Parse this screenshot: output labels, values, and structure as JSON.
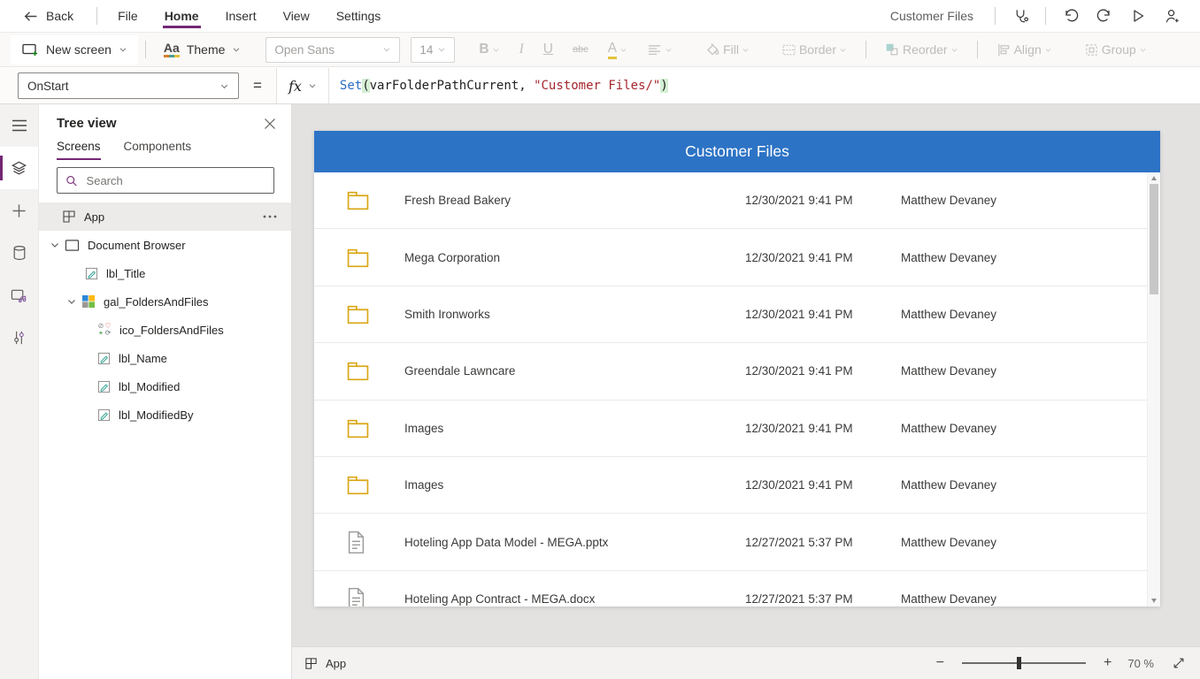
{
  "top_bar": {
    "back_label": "Back",
    "menus": [
      "File",
      "Home",
      "Insert",
      "View",
      "Settings"
    ],
    "active_menu": "Home",
    "app_name": "Customer Files",
    "right_icons": [
      "app-checker-icon",
      "undo-icon",
      "redo-icon",
      "play-icon",
      "share-person-add-icon"
    ]
  },
  "toolbar": {
    "new_screen_label": "New screen",
    "theme_label": "Theme",
    "theme_glyph": "Aa",
    "font_name": "Open Sans",
    "font_size": "14",
    "bold_glyph": "B",
    "italic_glyph": "I",
    "underline_glyph": "U",
    "strike_glyph": "abc",
    "font_color_glyph": "A",
    "fill_label": "Fill",
    "border_label": "Border",
    "reorder_label": "Reorder",
    "align_label": "Align",
    "group_label": "Group"
  },
  "formula_bar": {
    "property": "OnStart",
    "equals": "=",
    "fx": "fx",
    "formula": {
      "func": "Set",
      "open_paren": "(",
      "args": "varFolderPathCurrent, ",
      "string": "\"Customer Files/\"",
      "close_paren": ")"
    }
  },
  "left_rail": {
    "icons": [
      "hamburger-icon",
      "tree-view-icon",
      "insert-plus-icon",
      "data-icon",
      "media-icon",
      "advanced-tools-icon"
    ],
    "selected": "tree-view-icon"
  },
  "tree_panel": {
    "title": "Tree view",
    "tabs": [
      "Screens",
      "Components"
    ],
    "active_tab": "Screens",
    "search_placeholder": "Search",
    "items": [
      {
        "label": "App",
        "icon": "app-icon",
        "selected": true,
        "has_more": true
      },
      {
        "label": "Document Browser",
        "icon": "screen-icon",
        "expanded": true
      },
      {
        "label": "lbl_Title",
        "icon": "label-icon"
      },
      {
        "label": "gal_FoldersAndFiles",
        "icon": "gallery-icon",
        "expanded": true
      },
      {
        "label": "ico_FoldersAndFiles",
        "icon": "icon-control-icon"
      },
      {
        "label": "lbl_Name",
        "icon": "label-icon"
      },
      {
        "label": "lbl_Modified",
        "icon": "label-icon"
      },
      {
        "label": "lbl_ModifiedBy",
        "icon": "label-icon"
      }
    ]
  },
  "canvas": {
    "header_title": "Customer Files",
    "rows": [
      {
        "icon": "folder-icon",
        "name": "Fresh Bread Bakery",
        "modified": "12/30/2021 9:41 PM",
        "modified_by": "Matthew Devaney"
      },
      {
        "icon": "folder-icon",
        "name": "Mega Corporation",
        "modified": "12/30/2021 9:41 PM",
        "modified_by": "Matthew Devaney"
      },
      {
        "icon": "folder-icon",
        "name": "Smith Ironworks",
        "modified": "12/30/2021 9:41 PM",
        "modified_by": "Matthew Devaney"
      },
      {
        "icon": "folder-icon",
        "name": "Greendale Lawncare",
        "modified": "12/30/2021 9:41 PM",
        "modified_by": "Matthew Devaney"
      },
      {
        "icon": "folder-icon",
        "name": "Images",
        "modified": "12/30/2021 9:41 PM",
        "modified_by": "Matthew Devaney"
      },
      {
        "icon": "folder-icon",
        "name": "Images",
        "modified": "12/30/2021 9:41 PM",
        "modified_by": "Matthew Devaney"
      },
      {
        "icon": "file-icon",
        "name": "Hoteling App Data Model - MEGA.pptx",
        "modified": "12/27/2021 5:37 PM",
        "modified_by": "Matthew Devaney"
      },
      {
        "icon": "file-icon",
        "name": "Hoteling App Contract - MEGA.docx",
        "modified": "12/27/2021 5:37 PM",
        "modified_by": "Matthew Devaney"
      }
    ]
  },
  "status_bar": {
    "screen_label": "App",
    "zoom_value": "70 %"
  },
  "colors": {
    "accent_purple": "#742774",
    "header_blue": "#2d73c5",
    "folder_gold": "#d9a613",
    "file_gray": "#9d9b99",
    "string_red": "#a4262c",
    "function_blue": "#2b6bc2",
    "canvas_gray": "#e3e2e1"
  }
}
